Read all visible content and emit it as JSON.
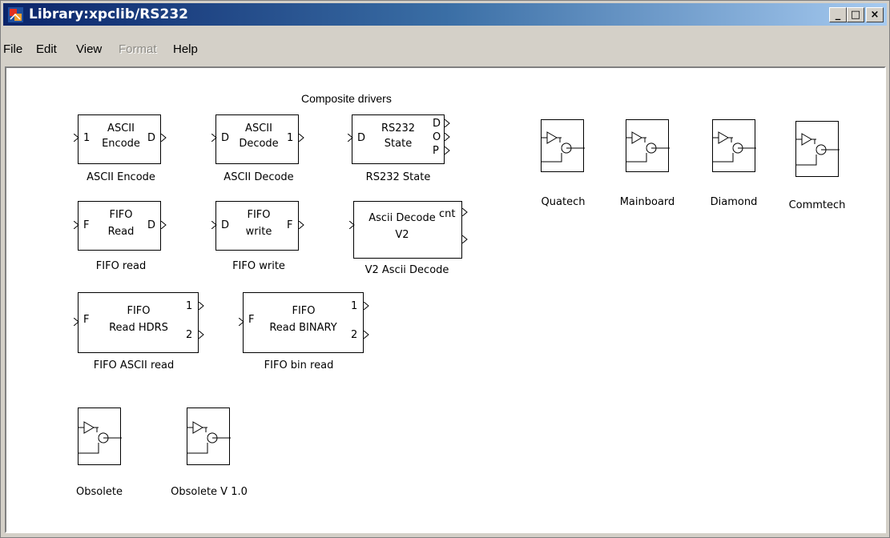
{
  "window": {
    "title": "Library:xpclib/RS232",
    "min": "_",
    "max": "□",
    "close": "×"
  },
  "menu": [
    {
      "label": "File",
      "enabled": true
    },
    {
      "label": "Edit",
      "enabled": true
    },
    {
      "label": "View",
      "enabled": true
    },
    {
      "label": "Format",
      "enabled": false
    },
    {
      "label": "Help",
      "enabled": true
    }
  ],
  "section_title": "Composite drivers",
  "blocks": {
    "ascii_encode": {
      "line1": "ASCII",
      "line2": "Encode",
      "in": "1",
      "out": "D",
      "label": "ASCII Encode"
    },
    "ascii_decode": {
      "line1": "ASCII",
      "line2": "Decode",
      "in": "D",
      "out": "1",
      "label": "ASCII Decode"
    },
    "rs232_state": {
      "line1": "RS232",
      "line2": "State",
      "in": "D",
      "out1": "D",
      "out2": "O",
      "out3": "P",
      "label": "RS232 State"
    },
    "fifo_read": {
      "line1": "FIFO",
      "line2": "Read",
      "in": "F",
      "out": "D",
      "label": "FIFO read"
    },
    "fifo_write": {
      "line1": "FIFO",
      "line2": "write",
      "in": "D",
      "out": "F",
      "label": "FIFO write"
    },
    "v2_ascii_decode": {
      "line1": "Ascii Decode",
      "line2": "V2",
      "out1": "cnt",
      "label": "V2 Ascii Decode"
    },
    "fifo_ascii_read": {
      "line1": "FIFO",
      "line2": "Read HDRS",
      "in": "F",
      "out1": "1",
      "out2": "2",
      "label": "FIFO ASCII read"
    },
    "fifo_bin_read": {
      "line1": "FIFO",
      "line2": "Read BINARY",
      "in": "F",
      "out1": "1",
      "out2": "2",
      "label": "FIFO bin read"
    }
  },
  "subsystems": {
    "quatech": "Quatech",
    "mainboard": "Mainboard",
    "diamond": "Diamond",
    "commtech": "Commtech",
    "obsolete": "Obsolete",
    "obsolete_v1": "Obsolete V 1.0"
  },
  "icons": {
    "subsystem": "subsystem-icon",
    "app": "simulink-icon"
  }
}
